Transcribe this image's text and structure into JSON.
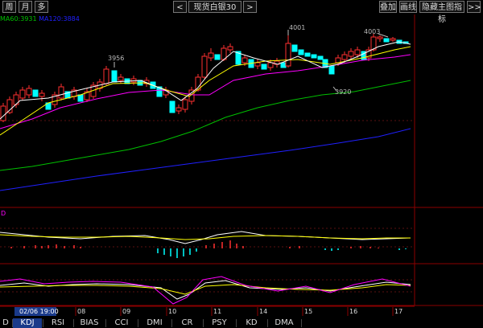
{
  "toolbar": {
    "period_buttons": [
      "周",
      "月",
      "多"
    ],
    "nav_prev": "<",
    "symbol": "现货白银30",
    "nav_next": ">",
    "right_buttons": [
      "叠加",
      "画线",
      "隐藏主图指标",
      ">>"
    ]
  },
  "indicator_line": {
    "ma60": "MA60:3931",
    "ma_other": "MA120:3884"
  },
  "price_annotations": {
    "high1": "3956",
    "high2": "4001",
    "high3": "4003",
    "low1": "3920"
  },
  "time_axis": {
    "current": "02/06 19:00",
    "labels": [
      "08",
      "09",
      "10",
      "11",
      "14",
      "15",
      "16",
      "17"
    ]
  },
  "macd_label": "D",
  "bottom_tabs": [
    "D",
    "KDJ",
    "RSI",
    "BIAS",
    "CCI",
    "DMI",
    "CR",
    "PSY",
    "KD",
    "DMA"
  ],
  "active_tab": "KDJ",
  "colors": {
    "up": "#ff3030",
    "down": "#00ffff",
    "ma_white": "#ffffff",
    "ma_yellow": "#ffff00",
    "ma_magenta": "#ff00ff",
    "ma_green": "#00c000",
    "ma_blue": "#2020ff",
    "grid": "#8b0000",
    "active_tab_bg": "#1a3a8a"
  }
}
